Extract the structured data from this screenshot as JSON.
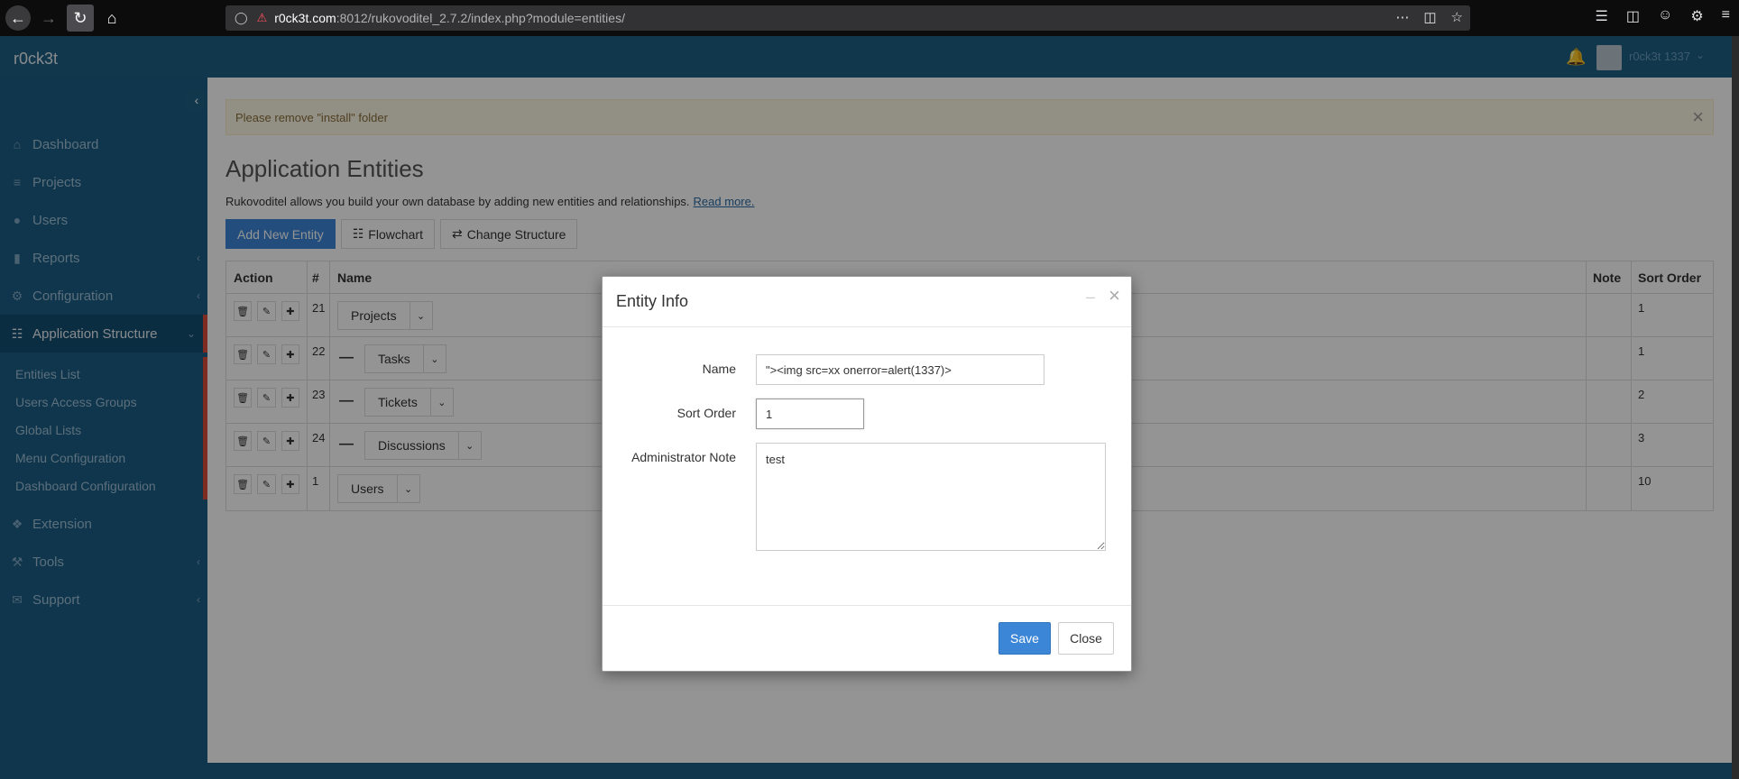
{
  "browser": {
    "url_host": "r0ck3t.com",
    "url_path": ":8012/rukovoditel_2.7.2/index.php?module=entities/",
    "url_more": "⋯"
  },
  "header": {
    "brand": "r0ck3t",
    "user_name": "r0ck3t 1337"
  },
  "sidebar": {
    "items": [
      {
        "label": "Dashboard",
        "icon": "home-icon"
      },
      {
        "label": "Projects",
        "icon": "list-icon"
      },
      {
        "label": "Users",
        "icon": "user-icon"
      },
      {
        "label": "Reports",
        "icon": "bar-chart-icon"
      },
      {
        "label": "Configuration",
        "icon": "gear-icon"
      },
      {
        "label": "Application Structure",
        "icon": "sitemap-icon"
      },
      {
        "label": "Extension",
        "icon": "puzzle-icon"
      },
      {
        "label": "Tools",
        "icon": "wrench-icon"
      },
      {
        "label": "Support",
        "icon": "envelope-icon"
      }
    ],
    "sub_items": [
      "Entities List",
      "Users Access Groups",
      "Global Lists",
      "Menu Configuration",
      "Dashboard Configuration"
    ]
  },
  "main": {
    "alert": "Please remove \"install\" folder",
    "title": "Application Entities",
    "description": "Rukovoditel allows you build your own database by adding new entities and relationships.",
    "read_more": "Read more.",
    "buttons": {
      "add": "Add New Entity",
      "flowchart": "Flowchart",
      "change_structure": "Change Structure"
    },
    "table": {
      "headers": {
        "action": "Action",
        "id": "#",
        "name": "Name",
        "note": "Note",
        "sort": "Sort Order"
      },
      "rows": [
        {
          "id": "21",
          "name": "Projects",
          "sort": "1"
        },
        {
          "id": "22",
          "name": "Tasks",
          "sort": "1"
        },
        {
          "id": "23",
          "name": "Tickets",
          "sort": "2"
        },
        {
          "id": "24",
          "name": "Discussions",
          "sort": "3"
        },
        {
          "id": "1",
          "name": "Users",
          "sort": "10"
        }
      ]
    }
  },
  "modal": {
    "title": "Entity Info",
    "name_label": "Name",
    "name_value": "\"><img src=xx onerror=alert(1337)>",
    "sort_label": "Sort Order",
    "sort_value": "1",
    "note_label": "Administrator Note",
    "note_value": "test",
    "save": "Save",
    "close": "Close"
  },
  "colors": {
    "header": "#1e5f85",
    "sidebar": "#1b5d86",
    "primary": "#3b86d6",
    "active_marker": "#d94b3a"
  }
}
